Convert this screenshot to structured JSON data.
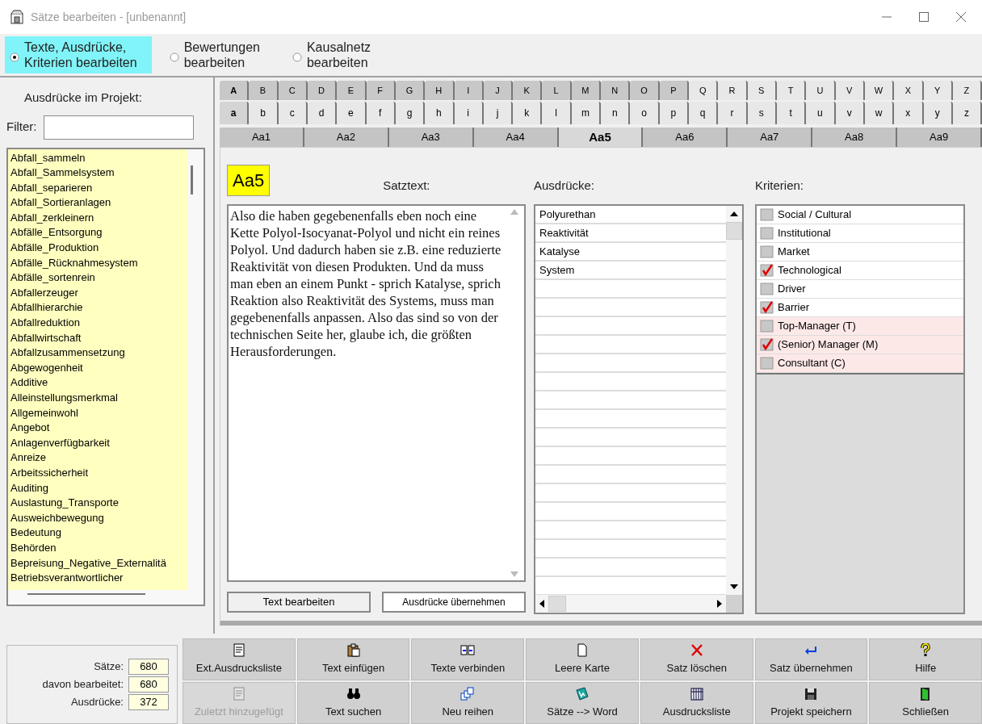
{
  "window": {
    "title": "Sätze bearbeiten - [unbenannt]"
  },
  "modes": [
    {
      "lines": [
        "Texte, Ausdrücke,",
        "Kriterien bearbeiten"
      ],
      "selected": true
    },
    {
      "lines": [
        "Bewertungen",
        "bearbeiten"
      ],
      "selected": false
    },
    {
      "lines": [
        "Kausalnetz",
        "bearbeiten"
      ],
      "selected": false
    }
  ],
  "left_panel": {
    "heading": "Ausdrücke im Projekt:",
    "filter_label": "Filter:",
    "items": [
      "Abfall_sammeln",
      "Abfall_Sammelsystem",
      "Abfall_separieren",
      "Abfall_Sortieranlagen",
      "Abfall_zerkleinern",
      "Abfälle_Entsorgung",
      "Abfälle_Produktion",
      "Abfälle_Rücknahmesystem",
      "Abfälle_sortenrein",
      "Abfallerzeuger",
      "Abfallhierarchie",
      "Abfallreduktion",
      "Abfallwirtschaft",
      "Abfallzusammensetzung",
      "Abgewogenheit",
      "Additive",
      "Alleinstellungsmerkmal",
      "Allgemeinwohl",
      "Angebot",
      "Anlagenverfügbarkeit",
      "Anreize",
      "Arbeitssicherheit",
      "Auditing",
      "Auslastung_Transporte",
      "Ausweichbewegung",
      "Bedeutung",
      "Behörden",
      "Bepreisung_Negative_Externalitä",
      "Betriebsverantwortlicher"
    ]
  },
  "upper_tabs": [
    {
      "label": "A",
      "selected": true,
      "highlighted": true
    },
    {
      "label": "B",
      "selected": false,
      "highlighted": true
    },
    {
      "label": "C",
      "selected": false,
      "highlighted": true
    },
    {
      "label": "D",
      "selected": false,
      "highlighted": true
    },
    {
      "label": "E",
      "selected": false,
      "highlighted": true
    },
    {
      "label": "F",
      "selected": false,
      "highlighted": true
    },
    {
      "label": "G",
      "selected": false,
      "highlighted": true
    },
    {
      "label": "H",
      "selected": false,
      "highlighted": true
    },
    {
      "label": "I",
      "selected": false,
      "highlighted": true
    },
    {
      "label": "J",
      "selected": false,
      "highlighted": true
    },
    {
      "label": "K",
      "selected": false,
      "highlighted": true
    },
    {
      "label": "L",
      "selected": false,
      "highlighted": true
    },
    {
      "label": "M",
      "selected": false,
      "highlighted": true
    },
    {
      "label": "N",
      "selected": false,
      "highlighted": true
    },
    {
      "label": "O",
      "selected": false,
      "highlighted": true
    },
    {
      "label": "P",
      "selected": false,
      "highlighted": true
    },
    {
      "label": "Q",
      "selected": false,
      "highlighted": false
    },
    {
      "label": "R",
      "selected": false,
      "highlighted": false
    },
    {
      "label": "S",
      "selected": false,
      "highlighted": false
    },
    {
      "label": "T",
      "selected": false,
      "highlighted": false
    },
    {
      "label": "U",
      "selected": false,
      "highlighted": false
    },
    {
      "label": "V",
      "selected": false,
      "highlighted": false
    },
    {
      "label": "W",
      "selected": false,
      "highlighted": false
    },
    {
      "label": "X",
      "selected": false,
      "highlighted": false
    },
    {
      "label": "Y",
      "selected": false,
      "highlighted": false
    },
    {
      "label": "Z",
      "selected": false,
      "highlighted": false
    }
  ],
  "lower_tabs": [
    {
      "label": "a",
      "selected": true
    },
    {
      "label": "b",
      "selected": false
    },
    {
      "label": "c",
      "selected": false
    },
    {
      "label": "d",
      "selected": false
    },
    {
      "label": "e",
      "selected": false
    },
    {
      "label": "f",
      "selected": false
    },
    {
      "label": "g",
      "selected": false
    },
    {
      "label": "h",
      "selected": false
    },
    {
      "label": "i",
      "selected": false
    },
    {
      "label": "j",
      "selected": false
    },
    {
      "label": "k",
      "selected": false
    },
    {
      "label": "l",
      "selected": false
    },
    {
      "label": "m",
      "selected": false
    },
    {
      "label": "n",
      "selected": false
    },
    {
      "label": "o",
      "selected": false
    },
    {
      "label": "p",
      "selected": false
    },
    {
      "label": "q",
      "selected": false
    },
    {
      "label": "r",
      "selected": false
    },
    {
      "label": "s",
      "selected": false
    },
    {
      "label": "t",
      "selected": false
    },
    {
      "label": "u",
      "selected": false
    },
    {
      "label": "v",
      "selected": false
    },
    {
      "label": "w",
      "selected": false
    },
    {
      "label": "x",
      "selected": false
    },
    {
      "label": "y",
      "selected": false
    },
    {
      "label": "z",
      "selected": false
    }
  ],
  "sentence_tabs": [
    {
      "label": "Aa1",
      "selected": false
    },
    {
      "label": "Aa2",
      "selected": false
    },
    {
      "label": "Aa3",
      "selected": false
    },
    {
      "label": "Aa4",
      "selected": false
    },
    {
      "label": "Aa5",
      "selected": true
    },
    {
      "label": "Aa6",
      "selected": false
    },
    {
      "label": "Aa7",
      "selected": false
    },
    {
      "label": "Aa8",
      "selected": false
    },
    {
      "label": "Aa9",
      "selected": false
    }
  ],
  "editor": {
    "badge": "Aa5",
    "label": "Satztext:",
    "text": "Also die haben gegebenenfalls eben noch eine Kette Polyol-Isocyanat-Polyol und nicht ein reines Polyol. Und dadurch haben sie z.B. eine reduzierte Reaktivität von diesen Produkten. Und da muss man eben an einem Punkt - sprich Katalyse, sprich Reaktion also Reaktivität des Systems, muss man gegebenenfalls anpassen. Also das sind so von der technischen Seite her, glaube ich, die größten Herausforderungen.",
    "edit_button": "Text bearbeiten",
    "apply_button": "Ausdrücke übernehmen"
  },
  "expressions": {
    "label": "Ausdrücke:",
    "items": [
      "Polyurethan",
      "Reaktivität",
      "Katalyse",
      "System"
    ]
  },
  "criteria": {
    "label": "Kriterien:",
    "items": [
      {
        "label": "Social / Cultural",
        "checked": false,
        "highlighted": false
      },
      {
        "label": "Institutional",
        "checked": false,
        "highlighted": false
      },
      {
        "label": "Market",
        "checked": false,
        "highlighted": false
      },
      {
        "label": "Technological",
        "checked": true,
        "highlighted": false
      },
      {
        "label": "Driver",
        "checked": false,
        "highlighted": false
      },
      {
        "label": "Barrier",
        "checked": true,
        "highlighted": false
      },
      {
        "label": "Top-Manager (T)",
        "checked": false,
        "highlighted": true
      },
      {
        "label": "(Senior) Manager (M)",
        "checked": true,
        "highlighted": true
      },
      {
        "label": "Consultant (C)",
        "checked": false,
        "highlighted": true
      }
    ]
  },
  "stats": [
    {
      "label": "Sätze:",
      "value": "680"
    },
    {
      "label": "davon bearbeitet:",
      "value": "680"
    },
    {
      "label": "Ausdrücke:",
      "value": "372"
    }
  ],
  "buttons": [
    {
      "label": "Ext.Ausdrucksliste",
      "kind": "list",
      "disabled": false
    },
    {
      "label": "Text einfügen",
      "kind": "paste",
      "disabled": false
    },
    {
      "label": "Texte verbinden",
      "kind": "merge",
      "disabled": false
    },
    {
      "label": "Leere Karte",
      "kind": "blank",
      "disabled": false
    },
    {
      "label": "Satz löschen",
      "kind": "delete",
      "disabled": false
    },
    {
      "label": "Satz übernehmen",
      "kind": "enter",
      "disabled": false
    },
    {
      "label": "Hilfe",
      "kind": "help",
      "disabled": false
    },
    {
      "label": "Zuletzt hinzugefügt",
      "kind": "list",
      "disabled": true
    },
    {
      "label": "Text suchen",
      "kind": "search",
      "disabled": false
    },
    {
      "label": "Neu reihen",
      "kind": "reorder",
      "disabled": false
    },
    {
      "label": "Sätze --> Word",
      "kind": "word",
      "disabled": false
    },
    {
      "label": "Ausdrucksliste",
      "kind": "columns",
      "disabled": false
    },
    {
      "label": "Projekt speichern",
      "kind": "save",
      "disabled": false
    },
    {
      "label": "Schließen",
      "kind": "exit",
      "disabled": false
    }
  ]
}
